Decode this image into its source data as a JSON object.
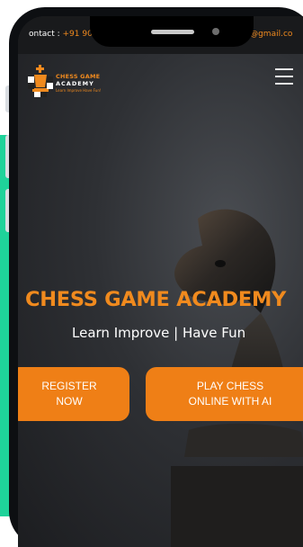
{
  "contact": {
    "left_label": "ontact : ",
    "left_phone": "+91 90",
    "right_email": "my@gmail.co"
  },
  "logo": {
    "title": "CHESS GAME",
    "subtitle": "ACADEMY",
    "tagline": "Learn Improve Have Fun!"
  },
  "hero": {
    "title": "CHESS GAME ACADEMY",
    "subtitle": "Learn Improve | Have Fun"
  },
  "buttons": {
    "register": [
      "REGISTER",
      "NOW"
    ],
    "play": [
      "PLAY CHESS",
      "ONLINE WITH AI"
    ]
  },
  "icons": {
    "menu": "hamburger-menu-icon",
    "logo": "chess-king-icon",
    "hero_image": "chess-knight-icon"
  },
  "colors": {
    "accent": "#f08a1e",
    "button": "#ef7f16",
    "strip": "#1fd39a",
    "background": "#2e3034"
  }
}
